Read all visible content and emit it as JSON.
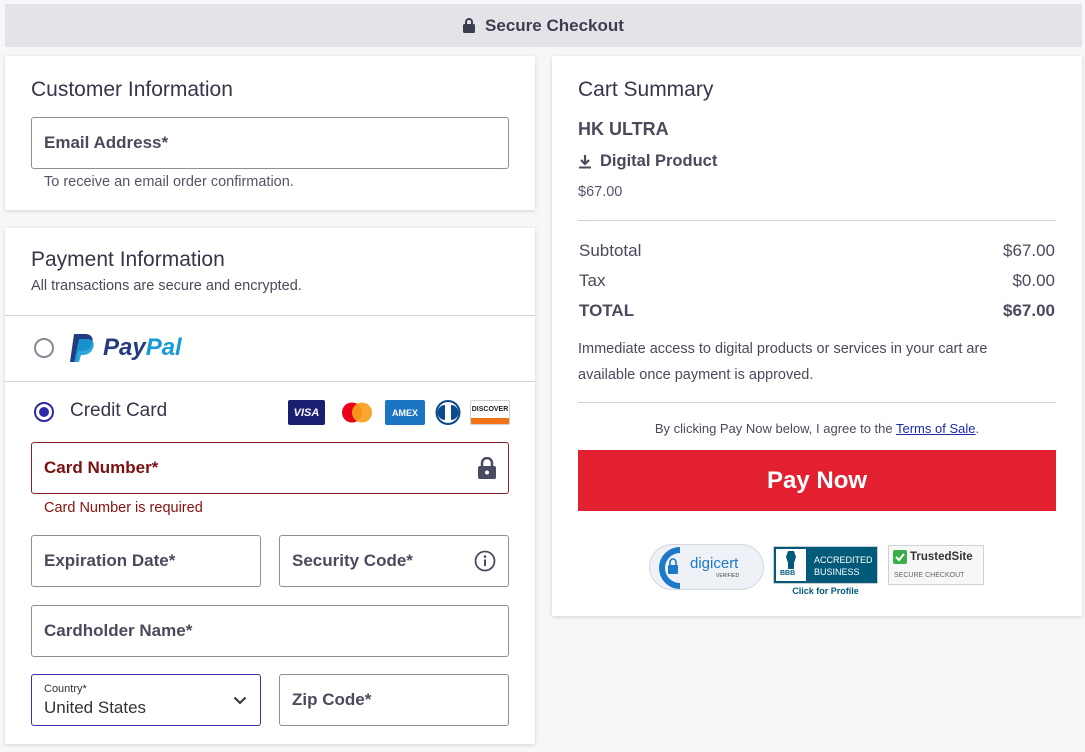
{
  "header": {
    "title": "Secure Checkout"
  },
  "customer": {
    "title": "Customer Information",
    "email_label": "Email Address*",
    "email_hint": "To receive an email order confirmation."
  },
  "payment": {
    "title": "Payment Information",
    "subtitle": "All transactions are secure and encrypted.",
    "paypal_label": "PayPal",
    "paypal_pay": "Pay",
    "paypal_pal": "Pal",
    "credit_label": "Credit Card",
    "card_brands": [
      "VISA",
      "AMEX",
      "DISCOVER"
    ],
    "card_number_label": "Card Number*",
    "card_number_error": "Card Number is required",
    "expiration_label": "Expiration Date*",
    "security_label": "Security Code*",
    "cardholder_label": "Cardholder Name*",
    "country_label": "Country*",
    "country_value": "United States",
    "zip_label": "Zip Code*"
  },
  "cart": {
    "title": "Cart Summary",
    "product_name": "HK ULTRA",
    "product_type": "Digital Product",
    "product_price": "$67.00",
    "subtotal_label": "Subtotal",
    "subtotal_value": "$67.00",
    "tax_label": "Tax",
    "tax_value": "$0.00",
    "total_label": "TOTAL",
    "total_value": "$67.00",
    "access_note_line1": "Immediate access to digital products or services in your cart are",
    "access_note_line2": "available once payment is approved.",
    "agree_text": "By clicking Pay Now below, I agree to the ",
    "terms_link": "Terms of Sale",
    "agree_end": ".",
    "pay_button": "Pay Now"
  },
  "badges": {
    "digicert": "digicert",
    "digicert_sub": "VERIFIED",
    "bbb_line1": "ACCREDITED",
    "bbb_line2": "BUSINESS",
    "bbb_logo": "BBB",
    "bbb_link": "Click for Profile",
    "trustedsite": "TrustedSite",
    "trustedsite_sub": "SECURE CHECKOUT"
  },
  "colors": {
    "pay_button": "#e3202f",
    "error": "#8a1010",
    "radio_selected": "#2d2aa8",
    "paypal_dark": "#253b80",
    "paypal_light": "#179bd7"
  }
}
